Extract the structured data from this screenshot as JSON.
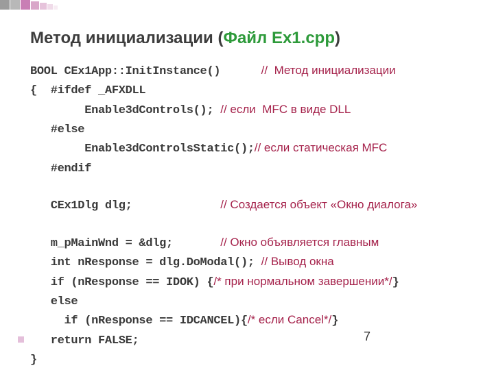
{
  "title": {
    "main": "Метод инициализации (",
    "file": "Файл Ex1.cpp",
    "close": ")"
  },
  "code": {
    "l1a": "BOOL CEx1App::InitInstance()      ",
    "l1c": "//  Метод инициализации",
    "l2a": "{  #ifdef _AFXDLL",
    "l3a": "        Enable3dControls(); ",
    "l3c": "// если  MFC в виде DLL",
    "l4a": "   #else",
    "l5a": "        Enable3dControlsStatic();",
    "l5c": "// если статическая MFC",
    "l6a": "   #endif",
    "l8a": "   CEx1Dlg dlg;             ",
    "l8c": "// Создается объект «Окно диалога»",
    "l10a": "   m_pMainWnd = &dlg;       ",
    "l10c": "// Окно объявляется главным",
    "l11a": "   int nResponse = dlg.DoModal(); ",
    "l11c": "// Вывод окна",
    "l12a": "   if (nResponse == IDOK) {",
    "l12c": "/* при нормальном завершении*/",
    "l12b": "}",
    "l13a": "   else",
    "l14a": "     if (nResponse == IDCANCEL){",
    "l14c": "/* если Cancel*/",
    "l14b": "}",
    "l15a": "   return FALSE;",
    "l16a": "}"
  },
  "page": "7"
}
